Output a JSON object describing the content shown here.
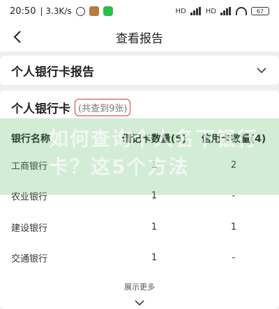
{
  "status": {
    "time": "20:50",
    "speed": "3.3K/s",
    "battery": "67",
    "net1": "HD",
    "net2": "HD"
  },
  "nav": {
    "title": "查看报告"
  },
  "collapsed_section": {
    "title": "个人银行卡报告"
  },
  "main_section": {
    "title": "个人银行卡",
    "count": "(共查到9张)"
  },
  "table": {
    "headers": [
      "银行名称",
      "借记卡数量(5)",
      "信用卡数量(4)"
    ],
    "rows": [
      [
        "工商银行",
        "1",
        "2"
      ],
      [
        "农业银行",
        "1",
        "-"
      ],
      [
        "建设银行",
        "1",
        "1"
      ],
      [
        "交通银行",
        "1",
        "-"
      ]
    ]
  },
  "show_more": "展示更多",
  "overlay_text": "如何查询个人名下银行卡？这5个方法"
}
